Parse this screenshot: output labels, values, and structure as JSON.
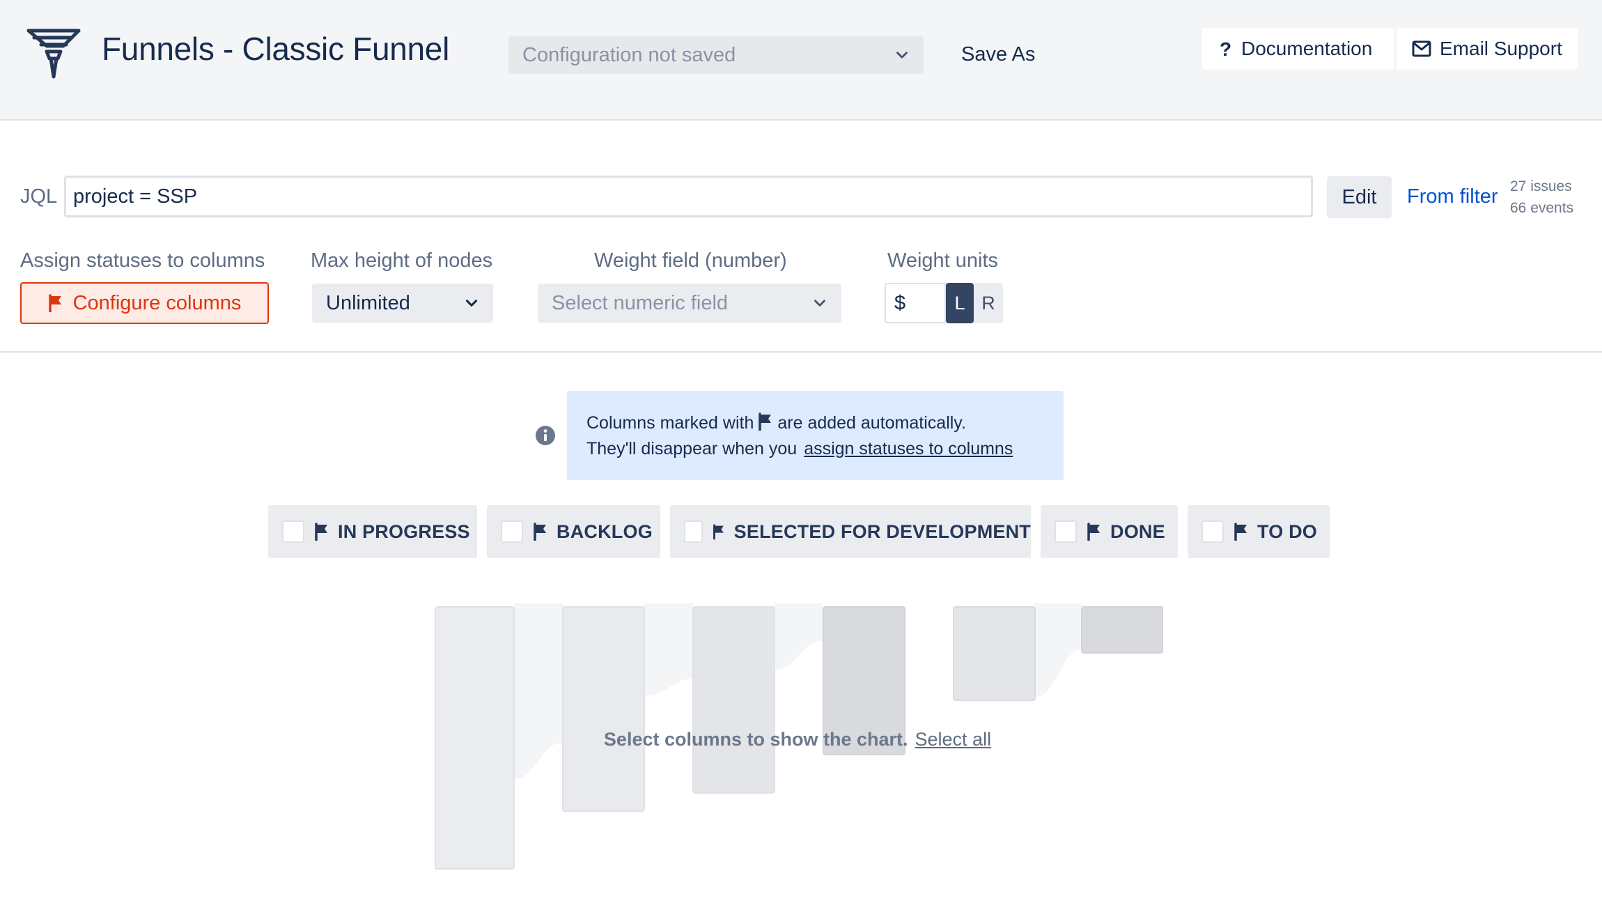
{
  "header": {
    "title": "Funnels - Classic Funnel",
    "config_select": "Configuration not saved",
    "save_as": "Save As",
    "documentation": "Documentation",
    "email_support": "Email Support"
  },
  "jql": {
    "label": "JQL",
    "value": "project = SSP",
    "edit": "Edit",
    "from_filter": "From filter",
    "issues": "27 issues",
    "events": "66 events"
  },
  "controls": {
    "assign_label": "Assign statuses to columns",
    "configure_button": "Configure columns",
    "max_height_label": "Max height of nodes",
    "max_height_value": "Unlimited",
    "weight_field_label": "Weight field (number)",
    "weight_field_placeholder": "Select numeric field",
    "weight_units_label": "Weight units",
    "weight_units_value": "$",
    "unit_left": "L",
    "unit_right": "R"
  },
  "info": {
    "line1_a": "Columns marked with",
    "line1_b": "are added automatically.",
    "line2": "They'll disappear when you",
    "link": "assign statuses to columns"
  },
  "columns": [
    {
      "label": "IN PROGRESS",
      "checked": false
    },
    {
      "label": "BACKLOG",
      "checked": false
    },
    {
      "label": "SELECTED FOR DEVELOPMENT",
      "checked": false
    },
    {
      "label": "DONE",
      "checked": false
    },
    {
      "label": "TO DO",
      "checked": false
    }
  ],
  "chart": {
    "message": "Select columns to show the chart.",
    "select_all": "Select all"
  },
  "colors": {
    "accent": "#0052cc",
    "danger": "#de350b",
    "info_bg": "#deebff",
    "dark": "#344563"
  }
}
